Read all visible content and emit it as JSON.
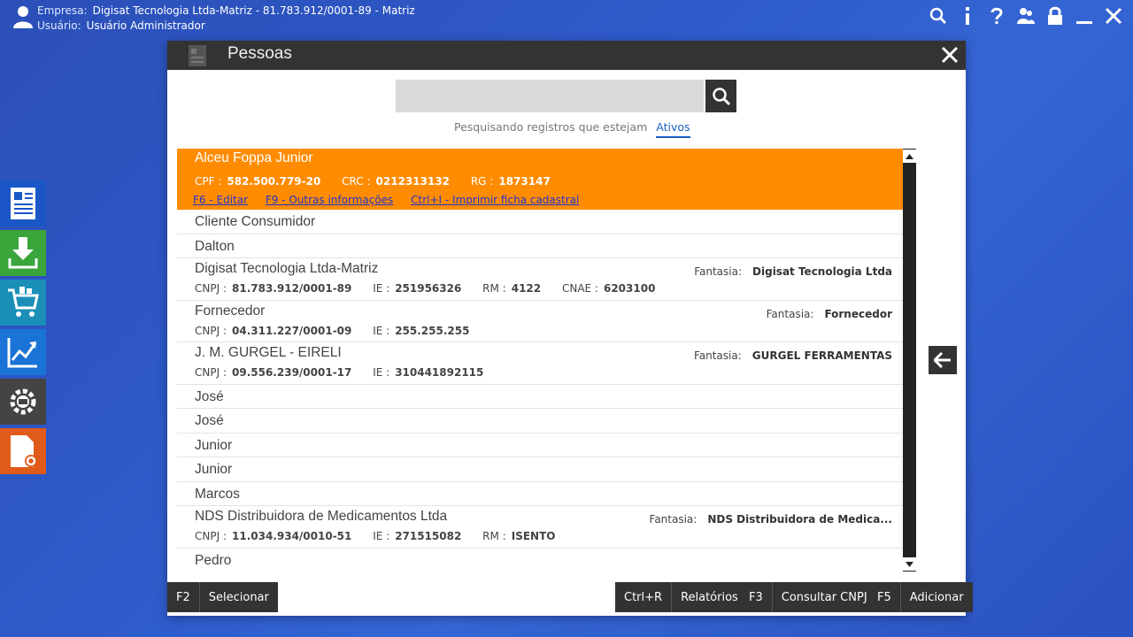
{
  "topbar": {
    "empresa_label": "Empresa:",
    "empresa_value": "Digisat Tecnologia Ltda-Matriz - 81.783.912/0001-89 - Matriz",
    "usuario_label": "Usuário:",
    "usuario_value": "Usuário Administrador",
    "icons": [
      "search-icon",
      "info-icon",
      "help-icon",
      "users-icon",
      "lock-icon",
      "minimize-icon",
      "close-icon"
    ]
  },
  "launcher": {
    "items": [
      "documents-icon",
      "download-icon",
      "cart-icon",
      "chart-icon",
      "settings-gear-icon",
      "file-settings-icon"
    ],
    "colors": [
      "#1a56c6",
      "#3aa53a",
      "#1b8fb8",
      "#1a73d6",
      "#444444",
      "#e05a1a"
    ]
  },
  "modal": {
    "title": "Pessoas",
    "search": {
      "value": "",
      "placeholder": ""
    },
    "filter_text": "Pesquisando registros que estejam",
    "filter_value": "Ativos",
    "selected": {
      "name": "Alceu Foppa Junior",
      "fields": [
        {
          "k": "CPF :",
          "v": "582.500.779-20"
        },
        {
          "k": "CRC :",
          "v": "0212313132"
        },
        {
          "k": "RG :",
          "v": "1873147"
        }
      ],
      "links": [
        "F6 - Editar",
        "F9 - Outras informações",
        "Ctrl+I - Imprimir ficha cadastral"
      ]
    },
    "rows": [
      {
        "name": "Cliente Consumidor"
      },
      {
        "name": "Dalton"
      },
      {
        "name": "Digisat Tecnologia Ltda-Matriz",
        "fields": [
          {
            "k": "CNPJ :",
            "v": "81.783.912/0001-89"
          },
          {
            "k": "IE :",
            "v": "251956326"
          },
          {
            "k": "RM :",
            "v": "4122"
          },
          {
            "k": "CNAE :",
            "v": "6203100"
          }
        ],
        "fantasia_label": "Fantasia:",
        "fantasia_value": "Digisat Tecnologia Ltda"
      },
      {
        "name": "Fornecedor",
        "fields": [
          {
            "k": "CNPJ :",
            "v": "04.311.227/0001-09"
          },
          {
            "k": "IE :",
            "v": "255.255.255"
          }
        ],
        "fantasia_label": "Fantasia:",
        "fantasia_value": "Fornecedor"
      },
      {
        "name": "J. M. GURGEL - EIRELI",
        "fields": [
          {
            "k": "CNPJ :",
            "v": "09.556.239/0001-17"
          },
          {
            "k": "IE :",
            "v": "310441892115"
          }
        ],
        "fantasia_label": "Fantasia:",
        "fantasia_value": "GURGEL FERRAMENTAS"
      },
      {
        "name": "José"
      },
      {
        "name": "José"
      },
      {
        "name": "Junior"
      },
      {
        "name": "Junior"
      },
      {
        "name": "Marcos"
      },
      {
        "name": "NDS Distribuidora de Medicamentos Ltda",
        "fields": [
          {
            "k": "CNPJ :",
            "v": "11.034.934/0010-51"
          },
          {
            "k": "IE :",
            "v": "271515082"
          },
          {
            "k": "RM :",
            "v": "ISENTO"
          }
        ],
        "fantasia_label": "Fantasia:",
        "fantasia_value": "NDS Distribuidora de Medica..."
      },
      {
        "name": "Pedro"
      }
    ],
    "footer": {
      "select_key": "F2",
      "select_label": "Selecionar",
      "reports_key": "Ctrl+R",
      "reports_label": "Relatórios",
      "cnpj_key": "F3",
      "cnpj_label": "Consultar CNPJ",
      "add_key": "F5",
      "add_label": "Adicionar"
    }
  },
  "colors": {
    "accent": "#ff8c00",
    "dark": "#333333",
    "link": "#2233cc",
    "active_filter": "#1a5fc4"
  }
}
